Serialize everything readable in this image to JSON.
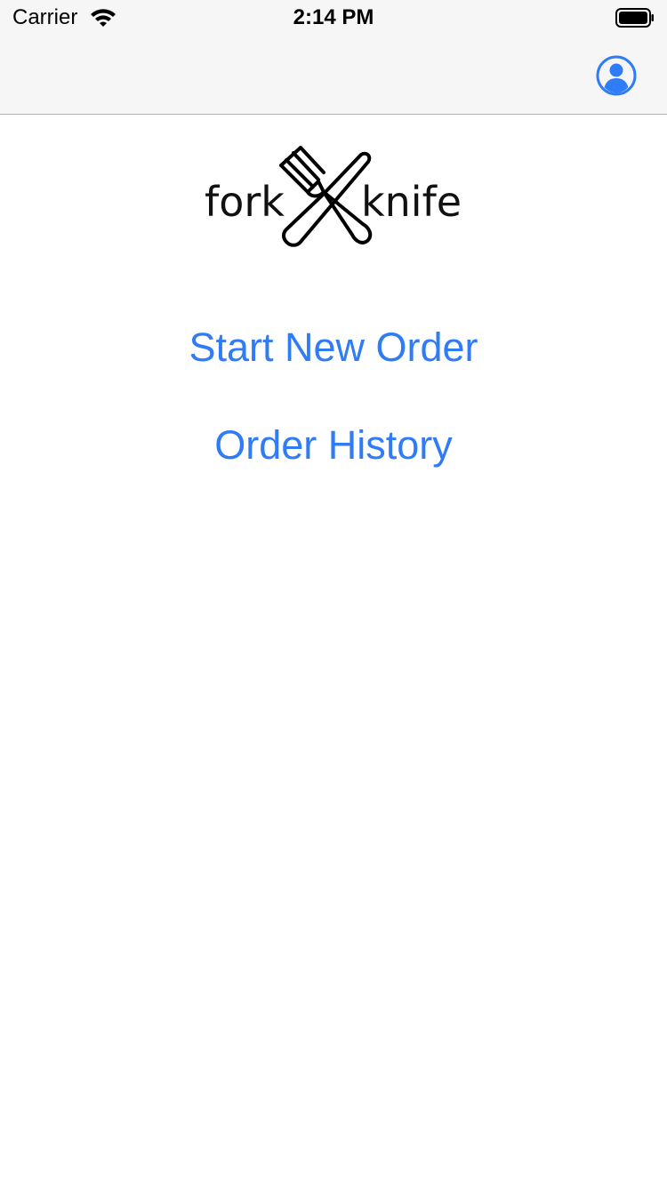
{
  "status_bar": {
    "carrier": "Carrier",
    "time": "2:14 PM",
    "wifi_icon": "wifi-icon",
    "battery_icon": "battery-icon"
  },
  "nav_bar": {
    "profile_icon": "person-circle-icon",
    "accent_color": "#2f7cf6"
  },
  "logo": {
    "left_word": "fork",
    "right_word": "knife"
  },
  "menu": {
    "start_new_order": "Start New Order",
    "order_history": "Order History"
  },
  "colors": {
    "link": "#2f7cf6",
    "bar_background": "#f6f6f7",
    "background": "#ffffff"
  }
}
